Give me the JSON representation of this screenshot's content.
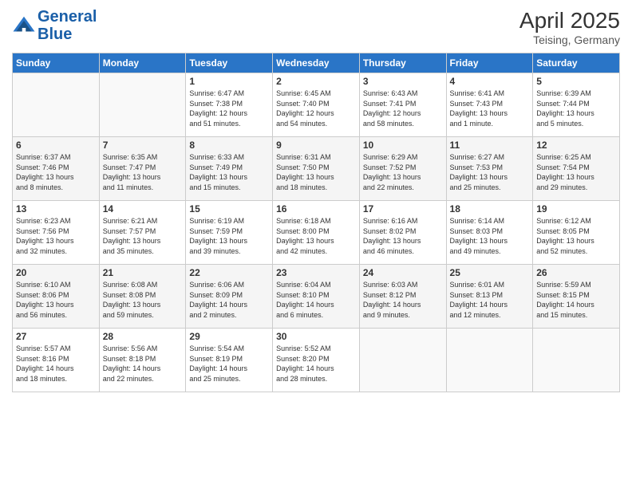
{
  "logo": {
    "line1": "General",
    "line2": "Blue"
  },
  "title": {
    "month_year": "April 2025",
    "location": "Teising, Germany"
  },
  "headers": [
    "Sunday",
    "Monday",
    "Tuesday",
    "Wednesday",
    "Thursday",
    "Friday",
    "Saturday"
  ],
  "weeks": [
    [
      {
        "day": "",
        "info": ""
      },
      {
        "day": "",
        "info": ""
      },
      {
        "day": "1",
        "info": "Sunrise: 6:47 AM\nSunset: 7:38 PM\nDaylight: 12 hours\nand 51 minutes."
      },
      {
        "day": "2",
        "info": "Sunrise: 6:45 AM\nSunset: 7:40 PM\nDaylight: 12 hours\nand 54 minutes."
      },
      {
        "day": "3",
        "info": "Sunrise: 6:43 AM\nSunset: 7:41 PM\nDaylight: 12 hours\nand 58 minutes."
      },
      {
        "day": "4",
        "info": "Sunrise: 6:41 AM\nSunset: 7:43 PM\nDaylight: 13 hours\nand 1 minute."
      },
      {
        "day": "5",
        "info": "Sunrise: 6:39 AM\nSunset: 7:44 PM\nDaylight: 13 hours\nand 5 minutes."
      }
    ],
    [
      {
        "day": "6",
        "info": "Sunrise: 6:37 AM\nSunset: 7:46 PM\nDaylight: 13 hours\nand 8 minutes."
      },
      {
        "day": "7",
        "info": "Sunrise: 6:35 AM\nSunset: 7:47 PM\nDaylight: 13 hours\nand 11 minutes."
      },
      {
        "day": "8",
        "info": "Sunrise: 6:33 AM\nSunset: 7:49 PM\nDaylight: 13 hours\nand 15 minutes."
      },
      {
        "day": "9",
        "info": "Sunrise: 6:31 AM\nSunset: 7:50 PM\nDaylight: 13 hours\nand 18 minutes."
      },
      {
        "day": "10",
        "info": "Sunrise: 6:29 AM\nSunset: 7:52 PM\nDaylight: 13 hours\nand 22 minutes."
      },
      {
        "day": "11",
        "info": "Sunrise: 6:27 AM\nSunset: 7:53 PM\nDaylight: 13 hours\nand 25 minutes."
      },
      {
        "day": "12",
        "info": "Sunrise: 6:25 AM\nSunset: 7:54 PM\nDaylight: 13 hours\nand 29 minutes."
      }
    ],
    [
      {
        "day": "13",
        "info": "Sunrise: 6:23 AM\nSunset: 7:56 PM\nDaylight: 13 hours\nand 32 minutes."
      },
      {
        "day": "14",
        "info": "Sunrise: 6:21 AM\nSunset: 7:57 PM\nDaylight: 13 hours\nand 35 minutes."
      },
      {
        "day": "15",
        "info": "Sunrise: 6:19 AM\nSunset: 7:59 PM\nDaylight: 13 hours\nand 39 minutes."
      },
      {
        "day": "16",
        "info": "Sunrise: 6:18 AM\nSunset: 8:00 PM\nDaylight: 13 hours\nand 42 minutes."
      },
      {
        "day": "17",
        "info": "Sunrise: 6:16 AM\nSunset: 8:02 PM\nDaylight: 13 hours\nand 46 minutes."
      },
      {
        "day": "18",
        "info": "Sunrise: 6:14 AM\nSunset: 8:03 PM\nDaylight: 13 hours\nand 49 minutes."
      },
      {
        "day": "19",
        "info": "Sunrise: 6:12 AM\nSunset: 8:05 PM\nDaylight: 13 hours\nand 52 minutes."
      }
    ],
    [
      {
        "day": "20",
        "info": "Sunrise: 6:10 AM\nSunset: 8:06 PM\nDaylight: 13 hours\nand 56 minutes."
      },
      {
        "day": "21",
        "info": "Sunrise: 6:08 AM\nSunset: 8:08 PM\nDaylight: 13 hours\nand 59 minutes."
      },
      {
        "day": "22",
        "info": "Sunrise: 6:06 AM\nSunset: 8:09 PM\nDaylight: 14 hours\nand 2 minutes."
      },
      {
        "day": "23",
        "info": "Sunrise: 6:04 AM\nSunset: 8:10 PM\nDaylight: 14 hours\nand 6 minutes."
      },
      {
        "day": "24",
        "info": "Sunrise: 6:03 AM\nSunset: 8:12 PM\nDaylight: 14 hours\nand 9 minutes."
      },
      {
        "day": "25",
        "info": "Sunrise: 6:01 AM\nSunset: 8:13 PM\nDaylight: 14 hours\nand 12 minutes."
      },
      {
        "day": "26",
        "info": "Sunrise: 5:59 AM\nSunset: 8:15 PM\nDaylight: 14 hours\nand 15 minutes."
      }
    ],
    [
      {
        "day": "27",
        "info": "Sunrise: 5:57 AM\nSunset: 8:16 PM\nDaylight: 14 hours\nand 18 minutes."
      },
      {
        "day": "28",
        "info": "Sunrise: 5:56 AM\nSunset: 8:18 PM\nDaylight: 14 hours\nand 22 minutes."
      },
      {
        "day": "29",
        "info": "Sunrise: 5:54 AM\nSunset: 8:19 PM\nDaylight: 14 hours\nand 25 minutes."
      },
      {
        "day": "30",
        "info": "Sunrise: 5:52 AM\nSunset: 8:20 PM\nDaylight: 14 hours\nand 28 minutes."
      },
      {
        "day": "",
        "info": ""
      },
      {
        "day": "",
        "info": ""
      },
      {
        "day": "",
        "info": ""
      }
    ]
  ]
}
